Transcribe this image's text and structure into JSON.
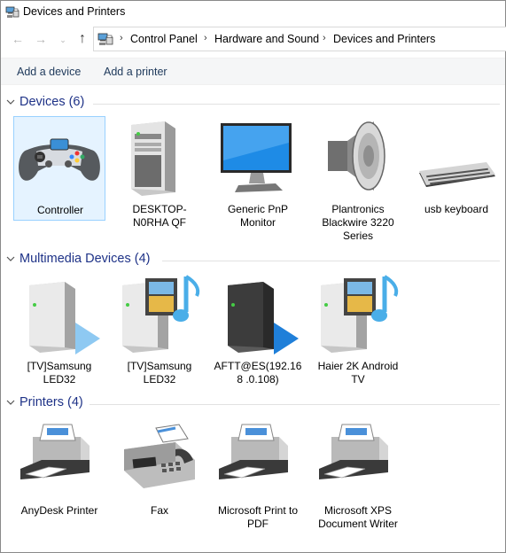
{
  "window": {
    "title": "Devices and Printers"
  },
  "address_bar": {
    "crumbs": [
      "Control Panel",
      "Hardware and Sound",
      "Devices and Printers"
    ]
  },
  "command_bar": {
    "add_device": "Add a device",
    "add_printer": "Add a printer"
  },
  "groups": {
    "devices": {
      "title": "Devices (6)",
      "items": [
        {
          "label": "Controller",
          "icon": "game-controller-icon"
        },
        {
          "label": "DESKTOP-N0RHA QF",
          "icon": "computer-tower-icon"
        },
        {
          "label": "Generic PnP Monitor",
          "icon": "monitor-icon"
        },
        {
          "label": "Plantronics Blackwire 3220 Series",
          "icon": "speaker-icon"
        },
        {
          "label": "usb keyboard",
          "icon": "keyboard-icon"
        }
      ]
    },
    "multimedia": {
      "title": "Multimedia Devices (4)",
      "items": [
        {
          "label": "[TV]Samsung LED32",
          "icon": "media-server-play-icon"
        },
        {
          "label": "[TV]Samsung LED32",
          "icon": "media-server-music-icon"
        },
        {
          "label": "AFTT@ES(192.168 .0.108)",
          "icon": "media-server-dark-play-icon"
        },
        {
          "label": "Haier 2K Android TV",
          "icon": "media-server-music-icon"
        }
      ]
    },
    "printers": {
      "title": "Printers (4)",
      "items": [
        {
          "label": "AnyDesk Printer",
          "icon": "printer-icon"
        },
        {
          "label": "Fax",
          "icon": "fax-icon"
        },
        {
          "label": "Microsoft Print to PDF",
          "icon": "printer-icon"
        },
        {
          "label": "Microsoft XPS Document Writer",
          "icon": "printer-icon"
        }
      ]
    }
  }
}
